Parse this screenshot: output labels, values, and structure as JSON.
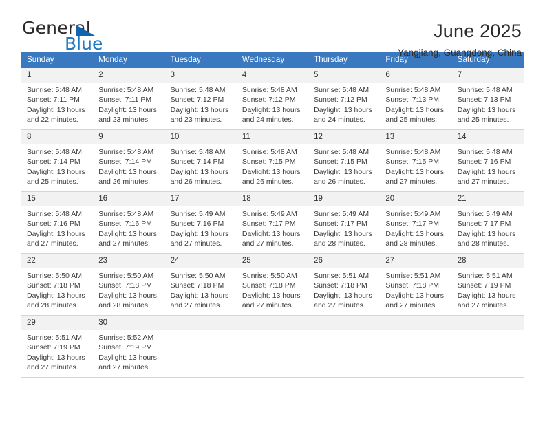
{
  "brand": {
    "name_top": "General",
    "name_bottom": "Blue",
    "accent_color": "#1f7bc4",
    "triangle_color": "#1463ad"
  },
  "header": {
    "title": "June 2025",
    "subtitle": "Yangjiang, Guangdong, China"
  },
  "calendar": {
    "header_bg": "#3a79c0",
    "daynum_bg": "#f2f2f2",
    "weekday_headers": [
      "Sunday",
      "Monday",
      "Tuesday",
      "Wednesday",
      "Thursday",
      "Friday",
      "Saturday"
    ],
    "weeks": [
      [
        {
          "day": "1",
          "sunrise": "Sunrise: 5:48 AM",
          "sunset": "Sunset: 7:11 PM",
          "daylight_line1": "Daylight: 13 hours",
          "daylight_line2": "and 22 minutes."
        },
        {
          "day": "2",
          "sunrise": "Sunrise: 5:48 AM",
          "sunset": "Sunset: 7:11 PM",
          "daylight_line1": "Daylight: 13 hours",
          "daylight_line2": "and 23 minutes."
        },
        {
          "day": "3",
          "sunrise": "Sunrise: 5:48 AM",
          "sunset": "Sunset: 7:12 PM",
          "daylight_line1": "Daylight: 13 hours",
          "daylight_line2": "and 23 minutes."
        },
        {
          "day": "4",
          "sunrise": "Sunrise: 5:48 AM",
          "sunset": "Sunset: 7:12 PM",
          "daylight_line1": "Daylight: 13 hours",
          "daylight_line2": "and 24 minutes."
        },
        {
          "day": "5",
          "sunrise": "Sunrise: 5:48 AM",
          "sunset": "Sunset: 7:12 PM",
          "daylight_line1": "Daylight: 13 hours",
          "daylight_line2": "and 24 minutes."
        },
        {
          "day": "6",
          "sunrise": "Sunrise: 5:48 AM",
          "sunset": "Sunset: 7:13 PM",
          "daylight_line1": "Daylight: 13 hours",
          "daylight_line2": "and 25 minutes."
        },
        {
          "day": "7",
          "sunrise": "Sunrise: 5:48 AM",
          "sunset": "Sunset: 7:13 PM",
          "daylight_line1": "Daylight: 13 hours",
          "daylight_line2": "and 25 minutes."
        }
      ],
      [
        {
          "day": "8",
          "sunrise": "Sunrise: 5:48 AM",
          "sunset": "Sunset: 7:14 PM",
          "daylight_line1": "Daylight: 13 hours",
          "daylight_line2": "and 25 minutes."
        },
        {
          "day": "9",
          "sunrise": "Sunrise: 5:48 AM",
          "sunset": "Sunset: 7:14 PM",
          "daylight_line1": "Daylight: 13 hours",
          "daylight_line2": "and 26 minutes."
        },
        {
          "day": "10",
          "sunrise": "Sunrise: 5:48 AM",
          "sunset": "Sunset: 7:14 PM",
          "daylight_line1": "Daylight: 13 hours",
          "daylight_line2": "and 26 minutes."
        },
        {
          "day": "11",
          "sunrise": "Sunrise: 5:48 AM",
          "sunset": "Sunset: 7:15 PM",
          "daylight_line1": "Daylight: 13 hours",
          "daylight_line2": "and 26 minutes."
        },
        {
          "day": "12",
          "sunrise": "Sunrise: 5:48 AM",
          "sunset": "Sunset: 7:15 PM",
          "daylight_line1": "Daylight: 13 hours",
          "daylight_line2": "and 26 minutes."
        },
        {
          "day": "13",
          "sunrise": "Sunrise: 5:48 AM",
          "sunset": "Sunset: 7:15 PM",
          "daylight_line1": "Daylight: 13 hours",
          "daylight_line2": "and 27 minutes."
        },
        {
          "day": "14",
          "sunrise": "Sunrise: 5:48 AM",
          "sunset": "Sunset: 7:16 PM",
          "daylight_line1": "Daylight: 13 hours",
          "daylight_line2": "and 27 minutes."
        }
      ],
      [
        {
          "day": "15",
          "sunrise": "Sunrise: 5:48 AM",
          "sunset": "Sunset: 7:16 PM",
          "daylight_line1": "Daylight: 13 hours",
          "daylight_line2": "and 27 minutes."
        },
        {
          "day": "16",
          "sunrise": "Sunrise: 5:48 AM",
          "sunset": "Sunset: 7:16 PM",
          "daylight_line1": "Daylight: 13 hours",
          "daylight_line2": "and 27 minutes."
        },
        {
          "day": "17",
          "sunrise": "Sunrise: 5:49 AM",
          "sunset": "Sunset: 7:16 PM",
          "daylight_line1": "Daylight: 13 hours",
          "daylight_line2": "and 27 minutes."
        },
        {
          "day": "18",
          "sunrise": "Sunrise: 5:49 AM",
          "sunset": "Sunset: 7:17 PM",
          "daylight_line1": "Daylight: 13 hours",
          "daylight_line2": "and 27 minutes."
        },
        {
          "day": "19",
          "sunrise": "Sunrise: 5:49 AM",
          "sunset": "Sunset: 7:17 PM",
          "daylight_line1": "Daylight: 13 hours",
          "daylight_line2": "and 28 minutes."
        },
        {
          "day": "20",
          "sunrise": "Sunrise: 5:49 AM",
          "sunset": "Sunset: 7:17 PM",
          "daylight_line1": "Daylight: 13 hours",
          "daylight_line2": "and 28 minutes."
        },
        {
          "day": "21",
          "sunrise": "Sunrise: 5:49 AM",
          "sunset": "Sunset: 7:17 PM",
          "daylight_line1": "Daylight: 13 hours",
          "daylight_line2": "and 28 minutes."
        }
      ],
      [
        {
          "day": "22",
          "sunrise": "Sunrise: 5:50 AM",
          "sunset": "Sunset: 7:18 PM",
          "daylight_line1": "Daylight: 13 hours",
          "daylight_line2": "and 28 minutes."
        },
        {
          "day": "23",
          "sunrise": "Sunrise: 5:50 AM",
          "sunset": "Sunset: 7:18 PM",
          "daylight_line1": "Daylight: 13 hours",
          "daylight_line2": "and 28 minutes."
        },
        {
          "day": "24",
          "sunrise": "Sunrise: 5:50 AM",
          "sunset": "Sunset: 7:18 PM",
          "daylight_line1": "Daylight: 13 hours",
          "daylight_line2": "and 27 minutes."
        },
        {
          "day": "25",
          "sunrise": "Sunrise: 5:50 AM",
          "sunset": "Sunset: 7:18 PM",
          "daylight_line1": "Daylight: 13 hours",
          "daylight_line2": "and 27 minutes."
        },
        {
          "day": "26",
          "sunrise": "Sunrise: 5:51 AM",
          "sunset": "Sunset: 7:18 PM",
          "daylight_line1": "Daylight: 13 hours",
          "daylight_line2": "and 27 minutes."
        },
        {
          "day": "27",
          "sunrise": "Sunrise: 5:51 AM",
          "sunset": "Sunset: 7:18 PM",
          "daylight_line1": "Daylight: 13 hours",
          "daylight_line2": "and 27 minutes."
        },
        {
          "day": "28",
          "sunrise": "Sunrise: 5:51 AM",
          "sunset": "Sunset: 7:19 PM",
          "daylight_line1": "Daylight: 13 hours",
          "daylight_line2": "and 27 minutes."
        }
      ],
      [
        {
          "day": "29",
          "sunrise": "Sunrise: 5:51 AM",
          "sunset": "Sunset: 7:19 PM",
          "daylight_line1": "Daylight: 13 hours",
          "daylight_line2": "and 27 minutes."
        },
        {
          "day": "30",
          "sunrise": "Sunrise: 5:52 AM",
          "sunset": "Sunset: 7:19 PM",
          "daylight_line1": "Daylight: 13 hours",
          "daylight_line2": "and 27 minutes."
        },
        {
          "day": "",
          "sunrise": "",
          "sunset": "",
          "daylight_line1": "",
          "daylight_line2": ""
        },
        {
          "day": "",
          "sunrise": "",
          "sunset": "",
          "daylight_line1": "",
          "daylight_line2": ""
        },
        {
          "day": "",
          "sunrise": "",
          "sunset": "",
          "daylight_line1": "",
          "daylight_line2": ""
        },
        {
          "day": "",
          "sunrise": "",
          "sunset": "",
          "daylight_line1": "",
          "daylight_line2": ""
        },
        {
          "day": "",
          "sunrise": "",
          "sunset": "",
          "daylight_line1": "",
          "daylight_line2": ""
        }
      ]
    ]
  }
}
